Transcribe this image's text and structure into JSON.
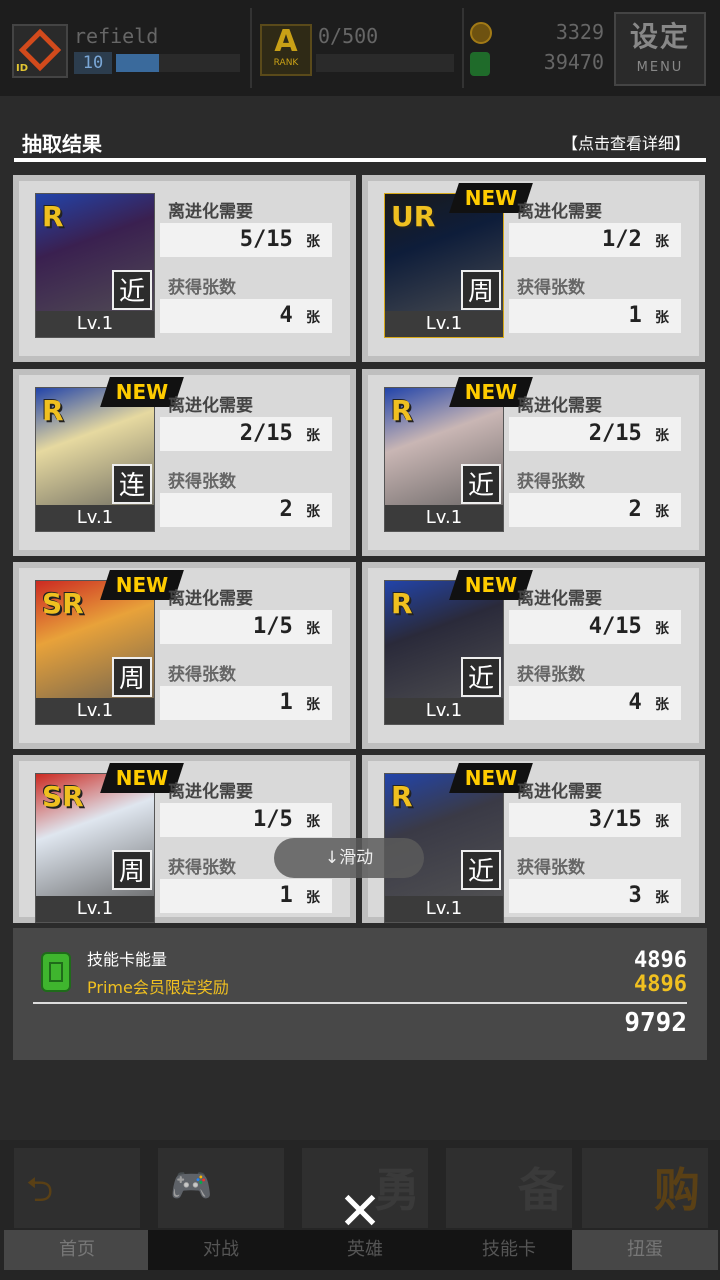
{
  "topbar": {
    "username": "refield",
    "level": "10",
    "level_progress": 0.35,
    "rank_value": "0/500",
    "rank_label": "RANK",
    "rank_letter": "A",
    "coins": "3329",
    "energy": "39470",
    "menu_zh": "设定",
    "menu_en": "MENU"
  },
  "header": {
    "title": "抽取结果",
    "detail_link": "【点击查看详细】"
  },
  "labels": {
    "evolve_need": "离进化需要",
    "obtained": "获得张数",
    "unit": "张",
    "lv": "Lv.1",
    "new": "NEW"
  },
  "cards": [
    {
      "rarity": "R",
      "type": "近",
      "need": "5",
      "need_total": "/15",
      "got": "4",
      "is_new": false,
      "bg": "#3a2050"
    },
    {
      "rarity": "UR",
      "type": "周",
      "need": "1",
      "need_total": "/2",
      "got": "1",
      "is_new": true,
      "bg": "#0e1d3a"
    },
    {
      "rarity": "R",
      "type": "连",
      "need": "2",
      "need_total": "/15",
      "got": "2",
      "is_new": true,
      "bg": "#e6d9a0"
    },
    {
      "rarity": "R",
      "type": "近",
      "need": "2",
      "need_total": "/15",
      "got": "2",
      "is_new": true,
      "bg": "#c9b6b4"
    },
    {
      "rarity": "SR",
      "type": "周",
      "need": "1",
      "need_total": "/5",
      "got": "1",
      "is_new": true,
      "bg": "#e8a23a"
    },
    {
      "rarity": "R",
      "type": "近",
      "need": "4",
      "need_total": "/15",
      "got": "4",
      "is_new": true,
      "bg": "#2a2a3a"
    },
    {
      "rarity": "SR",
      "type": "周",
      "need": "1",
      "need_total": "/5",
      "got": "1",
      "is_new": true,
      "bg": "#dfe6ef"
    },
    {
      "rarity": "R",
      "type": "近",
      "need": "3",
      "need_total": "/15",
      "got": "3",
      "is_new": true,
      "bg": "#3a3a46"
    }
  ],
  "summary": {
    "label": "技能卡能量",
    "prime_label": "Prime会员限定奖励",
    "base": "4896",
    "prime": "4896",
    "total": "9792"
  },
  "scroll_hint": "↓滑动",
  "nav": [
    {
      "label": "首页",
      "glyph": "⮌",
      "big": ""
    },
    {
      "label": "对战",
      "glyph": "🎮",
      "big": ""
    },
    {
      "label": "英雄",
      "glyph": "",
      "big": "勇"
    },
    {
      "label": "技能卡",
      "glyph": "",
      "big": "备"
    },
    {
      "label": "扭蛋",
      "glyph": "",
      "big": "购"
    }
  ],
  "close_symbol": "✕"
}
